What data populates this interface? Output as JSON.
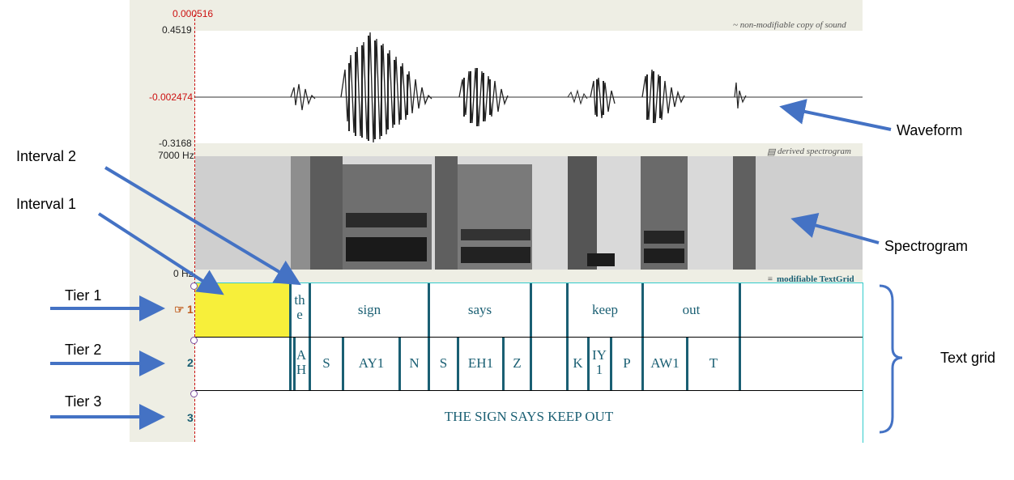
{
  "praat": {
    "cursor_time": "0.000516",
    "waveform": {
      "max_label": "0.4519",
      "cursor_value": "-0.002474",
      "min_label": "-0.3168",
      "caption": "~ non-modifiable copy of sound"
    },
    "spectrogram": {
      "top_label": "7000 Hz",
      "bottom_label": "0 Hz",
      "caption": "derived spectrogram"
    },
    "textgrid": {
      "caption": "modifiable TextGrid",
      "tiers": [
        {
          "number": "1",
          "intervals": [
            "",
            "the",
            "sign",
            "says",
            "",
            "keep",
            "out",
            ""
          ]
        },
        {
          "number": "2",
          "intervals": [
            "AH",
            "S",
            "AY1",
            "N",
            "S",
            "EH1",
            "Z",
            "K",
            "IY1",
            "P",
            "AW1",
            "T"
          ]
        },
        {
          "number": "3",
          "intervals": [
            "THE SIGN SAYS KEEP OUT"
          ]
        }
      ]
    }
  },
  "annotations": {
    "waveform": "Waveform",
    "spectrogram": "Spectrogram",
    "interval2": "Interval 2",
    "interval1": "Interval 1",
    "tier1": "Tier 1",
    "tier2": "Tier 2",
    "tier3": "Tier 3",
    "textgrid": "Text grid"
  },
  "colors": {
    "annotation_arrow": "#4472c4",
    "boundary": "#1a5f73",
    "selection": "#f7ef3a",
    "cursor": "#cc1010"
  }
}
